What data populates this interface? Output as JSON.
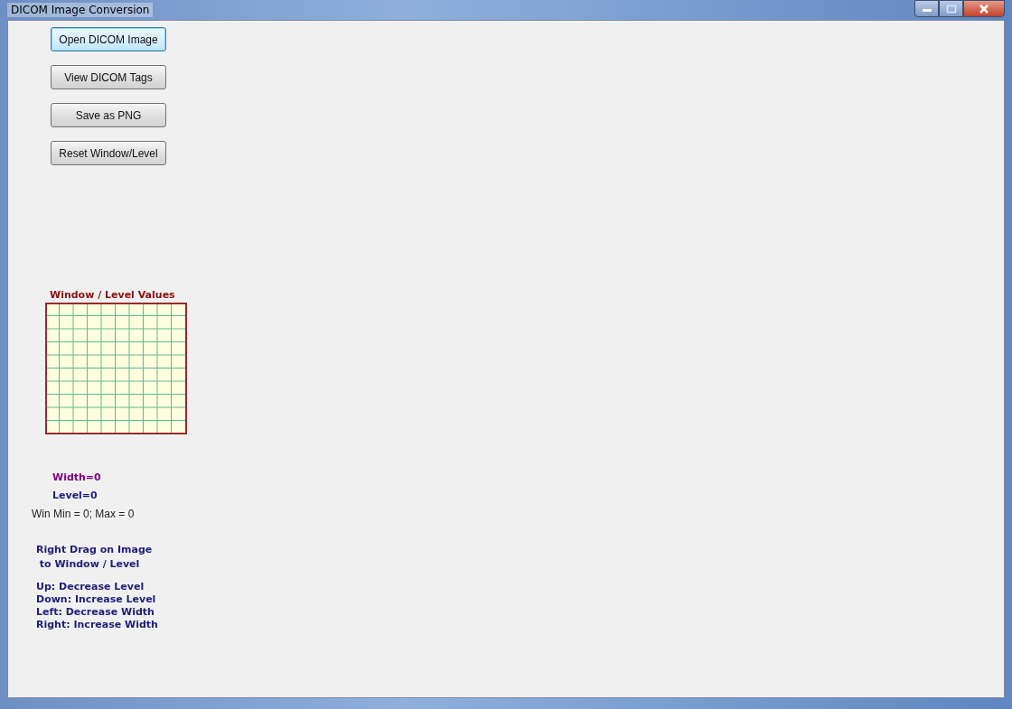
{
  "window": {
    "title": "DICOM Image Conversion"
  },
  "buttons": [
    {
      "label": "Open DICOM Image",
      "focused": true
    },
    {
      "label": "View DICOM Tags",
      "focused": false
    },
    {
      "label": "Save as PNG",
      "focused": false
    },
    {
      "label": "Reset Window/Level",
      "focused": false
    }
  ],
  "grid_panel": {
    "title": "Window / Level Values"
  },
  "readouts": {
    "width": "Width=0",
    "level": "Level=0",
    "range": "Win Min = 0; Max = 0"
  },
  "instructions": {
    "heading": [
      "Right Drag on Image",
      " to Window / Level"
    ],
    "lines": [
      "Up: Decrease Level",
      "Down: Increase Level",
      "Left: Decrease Width",
      "Right: Increase Width"
    ]
  }
}
